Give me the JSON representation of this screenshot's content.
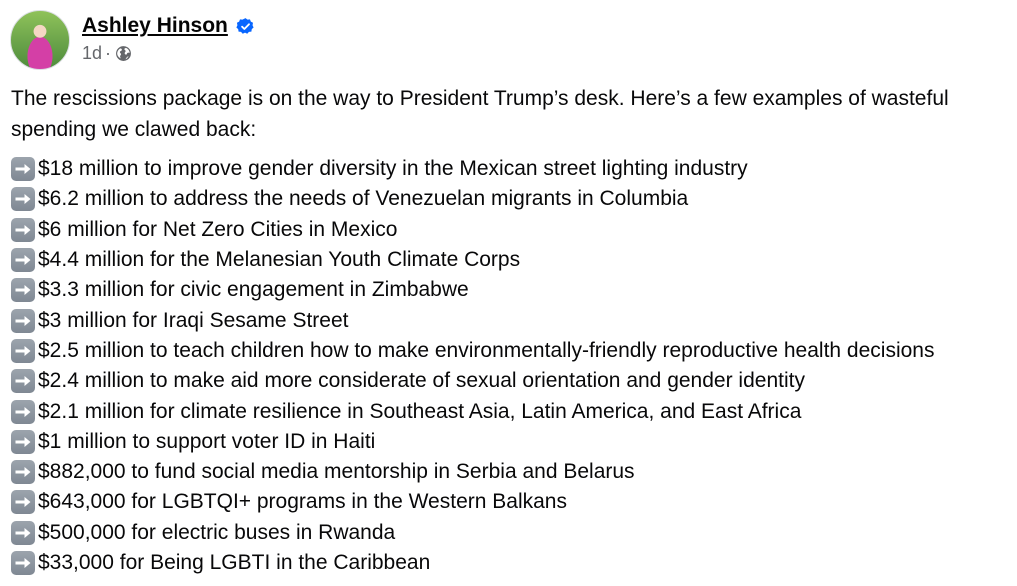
{
  "post": {
    "author": {
      "name": "Ashley Hinson",
      "verified_icon": "verified-badge-icon",
      "timestamp": "1d",
      "separator": "·",
      "audience_icon": "globe-icon"
    },
    "intro": "The rescissions package is on the way to President Trump’s desk. Here’s a few examples of wasteful spending we clawed back:",
    "bullet_icon": "right-arrow-emoji-icon",
    "items": [
      "$18 million to improve gender diversity in the Mexican street lighting industry",
      "$6.2 million to address the needs of Venezuelan migrants in Columbia",
      "$6 million for Net Zero Cities in Mexico",
      "$4.4 million for the Melanesian Youth Climate Corps",
      "$3.3 million for civic engagement in Zimbabwe",
      "$3 million for Iraqi Sesame Street",
      "$2.5 million to teach children how to make environmentally-friendly reproductive health decisions",
      "$2.4 million to make aid more considerate of sexual orientation and gender identity",
      "$2.1 million for climate resilience in Southeast Asia, Latin America, and East Africa",
      "$1 million to support voter ID in Haiti",
      "$882,000 to fund social media mentorship in Serbia and Belarus",
      "$643,000 for LGBTQI+ programs in the Western Balkans",
      "$500,000 for electric buses in Rwanda",
      "$33,000 for Being LGBTI in the Caribbean"
    ],
    "colors": {
      "name": "#050505",
      "meta": "#65676b",
      "verified": "#0866ff",
      "arrow_bg": "#8b939c"
    }
  }
}
